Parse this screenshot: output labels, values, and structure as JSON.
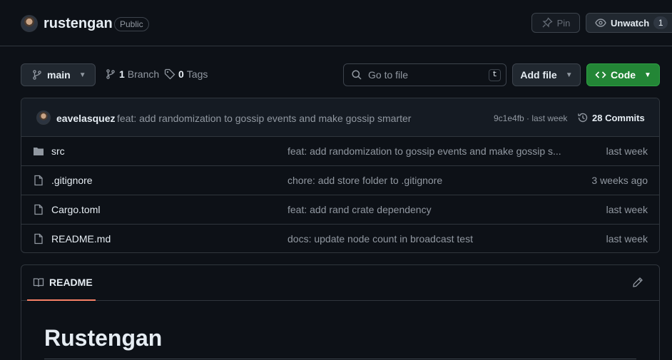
{
  "repo": {
    "name": "rustengan",
    "visibility": "Public"
  },
  "actions": {
    "pin_label": "Pin",
    "watch_label": "Unwatch",
    "watch_count": "1"
  },
  "toolbar": {
    "branch": "main",
    "branch_count": "1",
    "branch_label": "Branch",
    "tag_count": "0",
    "tag_label": "Tags",
    "search_placeholder": "Go to file",
    "search_shortcut": "t",
    "add_file_label": "Add file",
    "code_label": "Code"
  },
  "latest_commit": {
    "author": "eavelasquez",
    "message": "feat: add randomization to gossip events and make gossip smarter",
    "meta": "9c1e4fb · last week",
    "commits_label": "28 Commits"
  },
  "files": [
    {
      "name": "src",
      "type": "folder",
      "commit": "feat: add randomization to gossip events and make gossip s...",
      "date": "last week"
    },
    {
      "name": ".gitignore",
      "type": "file",
      "commit": "chore: add store folder to .gitignore",
      "date": "3 weeks ago"
    },
    {
      "name": "Cargo.toml",
      "type": "file",
      "commit": "feat: add rand crate dependency",
      "date": "last week"
    },
    {
      "name": "README.md",
      "type": "file",
      "commit": "docs: update node count in broadcast test",
      "date": "last week"
    }
  ],
  "readme": {
    "tab_label": "README",
    "title": "Rustengan"
  },
  "colors": {
    "background": "#0d1117",
    "border": "#30363d",
    "code_button": "#238636",
    "tab_underline": "#f78166"
  }
}
